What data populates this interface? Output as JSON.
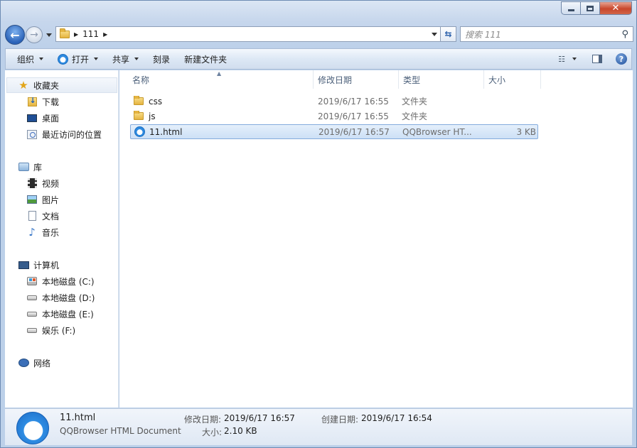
{
  "address": {
    "segment": "111"
  },
  "search": {
    "placeholder": "搜索 111"
  },
  "toolbar": {
    "organize": "组织",
    "open": "打开",
    "share": "共享",
    "burn": "刻录",
    "new_folder": "新建文件夹"
  },
  "nav": {
    "favorites": {
      "label": "收藏夹",
      "items": [
        "下载",
        "桌面",
        "最近访问的位置"
      ]
    },
    "libraries": {
      "label": "库",
      "items": [
        "视频",
        "图片",
        "文档",
        "音乐"
      ]
    },
    "computer": {
      "label": "计算机",
      "items": [
        "本地磁盘 (C:)",
        "本地磁盘 (D:)",
        "本地磁盘 (E:)",
        "娱乐 (F:)"
      ]
    },
    "network": {
      "label": "网络"
    }
  },
  "columns": {
    "name": "名称",
    "date": "修改日期",
    "type": "类型",
    "size": "大小"
  },
  "files": [
    {
      "name": "css",
      "date": "2019/6/17 16:55",
      "type": "文件夹",
      "size": "",
      "icon": "folder-icon"
    },
    {
      "name": "js",
      "date": "2019/6/17 16:55",
      "type": "文件夹",
      "size": "",
      "icon": "folder-icon"
    },
    {
      "name": "11.html",
      "date": "2019/6/17 16:57",
      "type": "QQBrowser HT...",
      "size": "3 KB",
      "icon": "qqbrowser-icon",
      "selected": true
    }
  ],
  "details": {
    "name": "11.html",
    "type": "QQBrowser HTML Document",
    "modified_label": "修改日期:",
    "modified": "2019/6/17 16:57",
    "created_label": "创建日期:",
    "created": "2019/6/17 16:54",
    "size_label": "大小:",
    "size": "2.10 KB"
  }
}
